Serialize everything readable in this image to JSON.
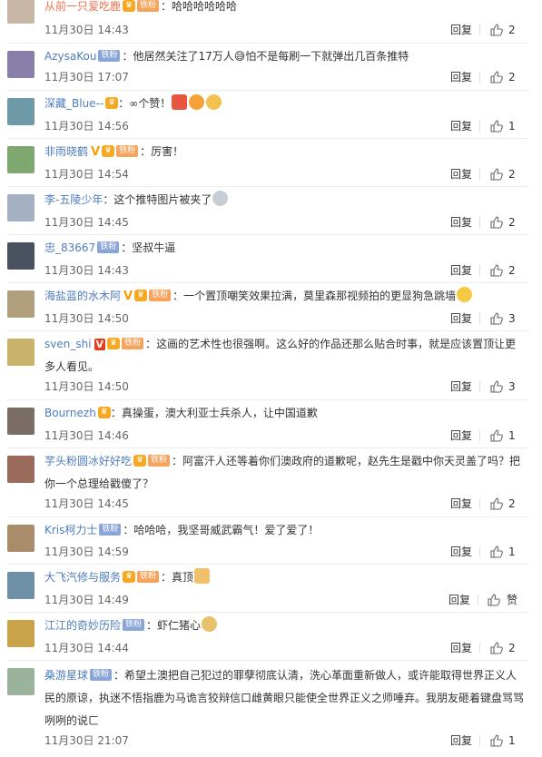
{
  "labels": {
    "reply": "回复",
    "like": "赞"
  },
  "colors": {
    "username": "#eb7350",
    "iron_badge": "#8aa6d8",
    "meta": "#666666"
  },
  "comments": [
    {
      "user": "从前一只爱吃鹿",
      "badge": "铁粉",
      "badge_type": "tie",
      "text": "哈哈哈哈哈哈",
      "time": "11月30日 14:43",
      "likes": "2",
      "avatar_color": "#c8b7a6"
    },
    {
      "user": "AzysaKou",
      "badge": "铁粉",
      "badge_type": "iron",
      "text": "他居然关注了17万人😅怕不是每刷一下就弹出几百条推特",
      "time": "11月30日 17:07",
      "likes": "2",
      "avatar_color": "#8a7fa8"
    },
    {
      "user": "深藏_Blue--",
      "badge": "",
      "badge_type": "tie",
      "text": "∞个赞！",
      "time": "11月30日 14:56",
      "likes": "1",
      "avatar_color": "#6e9aa8"
    },
    {
      "user": "非雨晓鹤",
      "badge": "铁粉",
      "badge_type": "tie",
      "text": "厉害！",
      "time": "11月30日 14:54",
      "likes": "2",
      "avatar_color": "#7fa770"
    },
    {
      "user": "李-五陵少年",
      "badge": "",
      "badge_type": "",
      "text": "这个推特图片被夹了",
      "time": "11月30日 14:45",
      "likes": "2",
      "avatar_color": "#a3b1c2"
    },
    {
      "user": "忠_83667",
      "badge": "铁粉",
      "badge_type": "iron",
      "text": "坚叔牛逼",
      "time": "11月30日 14:43",
      "likes": "2",
      "avatar_color": "#4a5260"
    },
    {
      "user": "海盐蓝的水木阿",
      "badge": "铁粉",
      "badge_type": "tie",
      "text": "一个置顶嘲笑效果拉满，莫里森那视频拍的更显狗急跳墙",
      "time": "11月30日 14:50",
      "likes": "3",
      "avatar_color": "#b0a07e"
    },
    {
      "user": "sven_shi",
      "badge": "铁粉",
      "badge_type": "tie",
      "text": "这画的艺术性也很强啊。这么好的作品还那么贴合时事，就是应该置顶让更多人看见。",
      "time": "11月30日 14:50",
      "likes": "3",
      "avatar_color": "#c9b26a"
    },
    {
      "user": "Bournezh",
      "badge": "",
      "badge_type": "",
      "text": "真操蛋，澳大利亚士兵杀人，让中国道歉",
      "time": "11月30日 14:46",
      "likes": "1",
      "avatar_color": "#7a6e66"
    },
    {
      "user": "芋头粉圆冰好好吃",
      "badge": "铁粉",
      "badge_type": "tie",
      "text": "阿富汗人还等着你们澳政府的道歉呢，赵先生是戳中你天灵盖了吗？把你一个总理给戳傻了？",
      "time": "11月30日 14:45",
      "likes": "2",
      "avatar_color": "#9a6a5c"
    },
    {
      "user": "Kris柯力士",
      "badge": "铁粉",
      "badge_type": "iron",
      "text": "哈哈哈，我坚哥威武霸气！爱了爱了！",
      "time": "11月30日 14:59",
      "likes": "1",
      "avatar_color": "#a98c6a"
    },
    {
      "user": "大飞汽修与服务",
      "badge": "铁粉",
      "badge_type": "tie",
      "text": "真顶",
      "time": "11月30日 14:49",
      "likes": "赞",
      "avatar_color": "#6e8fa6"
    },
    {
      "user": "江江的奇妙历险",
      "badge": "铁粉",
      "badge_type": "iron",
      "text": "虾仁猪心",
      "time": "11月30日 14:44",
      "likes": "2",
      "avatar_color": "#caa24a"
    },
    {
      "user": "桑游星球",
      "badge": "铁粉",
      "badge_type": "iron",
      "text": "希望土澳把自己犯过的罪孽彻底认清，洗心革面重新做人，或许能取得世界正义人民的原谅，执迷不悟指鹿为马诡言狡辩信口雌黄眼只能使全世界正义之师唾弃。我朋友砸着键盘骂骂咧咧的说ㄈ",
      "time": "11月30日 21:07",
      "likes": "1",
      "avatar_color": "#9bb39b"
    }
  ]
}
